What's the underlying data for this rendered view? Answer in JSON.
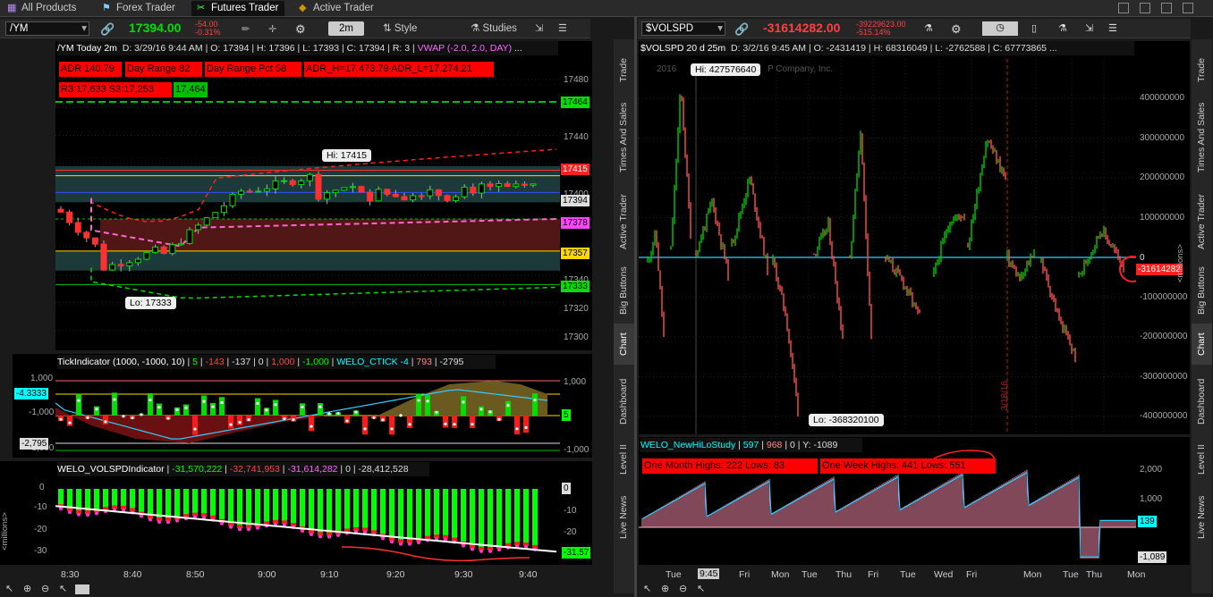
{
  "top_tabs": [
    {
      "label": "All Products",
      "icon": "grid-icon"
    },
    {
      "label": "Forex Trader",
      "icon": "flag-icon"
    },
    {
      "label": "Futures Trader",
      "icon": "scissors-icon"
    },
    {
      "label": "Active Trader",
      "icon": "lightning-icon"
    }
  ],
  "left": {
    "symbol": "/YM",
    "price": "17394.00",
    "change": "-54.00",
    "change_pct": "-0.31%",
    "timeframe": "2m",
    "style_label": "Style",
    "studies_label": "Studies",
    "info": {
      "name": "/YM Today 2m",
      "date": "D: 3/29/16 9:44 AM",
      "open": "O: 17394",
      "high": "H: 17396",
      "low": "L: 17393",
      "close": "C: 17394",
      "r": "R: 3",
      "vwap": "VWAP (-2.0, 2.0, DAY)",
      "dots": "..."
    },
    "labels": {
      "adr": "ADR 140.79",
      "day_range": "Day Range 82",
      "day_range_pct": "Day Range Pct 58",
      "adr_hl": "ADR_H=17,473.79 ADR_L=17,274.21",
      "r3s3": "R3:17,633 S3:17,253",
      "green": "17,464"
    },
    "hi_bubble": "Hi: 17415",
    "lo_bubble": "Lo: 17333",
    "yaxis": [
      "17480",
      "17460",
      "17440",
      "17420",
      "17400",
      "17380",
      "17360",
      "17340",
      "17320",
      "17300"
    ],
    "tags": {
      "t17464": "17464",
      "t17415": "17415",
      "t17394": "17394",
      "t17378": "17378",
      "t17357": "17357",
      "t17333": "17333"
    },
    "tick": {
      "name": "TickIndicator (1000, -1000, 10)",
      "v1": "5",
      "v2": "-143",
      "v3": "-137",
      "v4": "0",
      "v5": "1,000",
      "v6": "-1,000",
      "welo": "WELO_CTICK",
      "w1": "-4",
      "w2": "793",
      "w3": "-2795",
      "yleft": [
        "1,000",
        "-1,000",
        "-3,000"
      ],
      "yright": [
        "1,000",
        "-1,000"
      ],
      "tag_left_cyan": "-4.3333",
      "tag_left_white": "-2,795",
      "tag_right_green": "5"
    },
    "vol": {
      "name": "WELO_VOLSPDIndicator",
      "v1": "-31,570,222",
      "v2": "-32,741,953",
      "v3": "-31,614,282",
      "v4": "0",
      "v5": "-28,412,528",
      "yleft": [
        "0",
        "-10",
        "-20",
        "-30"
      ],
      "yright": [
        "-10",
        "-20",
        "-30"
      ],
      "tag_zero": "0",
      "tag_last": "-31.57",
      "unit": "<millions>"
    },
    "xaxis": [
      "8:30",
      "8:40",
      "8:50",
      "9:00",
      "9:10",
      "9:20",
      "9:30",
      "9:40"
    ]
  },
  "right": {
    "symbol": "$VOLSPD",
    "price": "-31614282.00",
    "change": "-39229623.00",
    "change_pct": "-515.14%",
    "info": {
      "name": "$VOLSPD 20 d 25m",
      "date": "D: 3/2/16 9:45 AM",
      "open": "O: -2431419",
      "high": "H: 68316049",
      "low": "L: -2762588",
      "close": "C: 67773865",
      "dots": "..."
    },
    "watermark_year": "2016",
    "watermark": "P Company, Inc.",
    "hi_bubble": "Hi: 427576640",
    "lo_bubble": "Lo: -368320100",
    "vline_label": "3/18/16",
    "yaxis": [
      "400000000",
      "300000000",
      "200000000",
      "100000000",
      "0",
      "-100000000",
      "-200000000",
      "-300000000",
      "-400000000"
    ],
    "unit": "<millions>",
    "tag_zero": "0",
    "tag_last": "-31614282",
    "newhilo": {
      "name": "WELO_NewHiLoStudy",
      "v1": "597",
      "v2": "968",
      "v3": "0",
      "v4": "Y: -1089",
      "month": "One Month Highs: 222 Lows: 83",
      "week": "One Week Highs: 441 Lows: 551",
      "yright": [
        "2,000",
        "1,000",
        "0"
      ],
      "tag_cyan": "139",
      "tag_white": "-1,089"
    },
    "xaxis": [
      "Tue",
      "Fri",
      "Mon",
      "Tue",
      "Thu",
      "Fri",
      "Tue",
      "Wed",
      "Fri",
      "Mon",
      "Tue",
      "Thu",
      "Mon"
    ],
    "xaxis_time": "9:45"
  },
  "sidebar": [
    "Trade",
    "Times And Sales",
    "Active Trader",
    "Big Buttons",
    "Chart",
    "Dashboard",
    "Level II",
    "Live News"
  ],
  "colors": {
    "red": "#ff0000",
    "green": "#00e000",
    "cyan": "#00ffff",
    "pink": "#ff66cc",
    "yellow": "#ffd700"
  }
}
